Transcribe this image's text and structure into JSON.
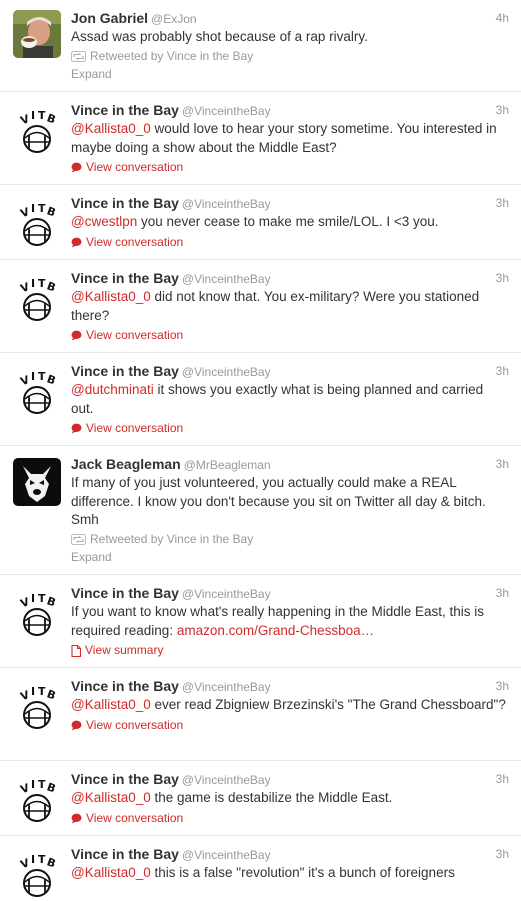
{
  "tweets": [
    {
      "name": "Jon Gabriel",
      "handle": "@ExJon",
      "time": "4h",
      "avatar": "photo-avatar",
      "segments": [
        {
          "type": "text",
          "value": "Assad was probably shot because of a rap rivalry."
        }
      ],
      "retweeted_by": "Retweeted by Vince in the Bay",
      "expand": "Expand"
    },
    {
      "name": "Vince in the Bay",
      "handle": "@VinceintheBay",
      "time": "3h",
      "avatar": "vitb-avatar",
      "segments": [
        {
          "type": "mention",
          "value": "@Kallista0_0"
        },
        {
          "type": "text",
          "value": " would love to hear your story sometime. You interested in maybe doing a show about the Middle East?"
        }
      ],
      "action": "View conversation",
      "action_icon": "speech-bubble-icon"
    },
    {
      "name": "Vince in the Bay",
      "handle": "@VinceintheBay",
      "time": "3h",
      "avatar": "vitb-avatar",
      "segments": [
        {
          "type": "mention",
          "value": "@cwestlpn"
        },
        {
          "type": "text",
          "value": " you never cease to make me smile/LOL. I <3 you."
        }
      ],
      "action": "View conversation",
      "action_icon": "speech-bubble-icon"
    },
    {
      "name": "Vince in the Bay",
      "handle": "@VinceintheBay",
      "time": "3h",
      "avatar": "vitb-avatar",
      "segments": [
        {
          "type": "mention",
          "value": "@Kallista0_0"
        },
        {
          "type": "text",
          "value": " did not know that. You ex-military? Were you stationed there?"
        }
      ],
      "action": "View conversation",
      "action_icon": "speech-bubble-icon"
    },
    {
      "name": "Vince in the Bay",
      "handle": "@VinceintheBay",
      "time": "3h",
      "avatar": "vitb-avatar",
      "segments": [
        {
          "type": "mention",
          "value": "@dutchminati"
        },
        {
          "type": "text",
          "value": " it shows you exactly what is being planned and carried out."
        }
      ],
      "action": "View conversation",
      "action_icon": "speech-bubble-icon"
    },
    {
      "name": "Jack Beagleman",
      "handle": "@MrBeagleman",
      "time": "3h",
      "avatar": "dog-avatar",
      "segments": [
        {
          "type": "text",
          "value": "If many of you just volunteered, you actually could make a REAL difference. I know you don't because you sit on Twitter all day & bitch. Smh"
        }
      ],
      "retweeted_by": "Retweeted by Vince in the Bay",
      "expand": "Expand"
    },
    {
      "name": "Vince in the Bay",
      "handle": "@VinceintheBay",
      "time": "3h",
      "avatar": "vitb-avatar",
      "segments": [
        {
          "type": "text",
          "value": "If you want to know what's really happening in the Middle East, this is required reading: "
        },
        {
          "type": "link",
          "value": "amazon.com/Grand-Chessboa…"
        }
      ],
      "action": "View summary",
      "action_icon": "document-icon"
    },
    {
      "name": "Vince in the Bay",
      "handle": "@VinceintheBay",
      "time": "3h",
      "avatar": "vitb-avatar",
      "segments": [
        {
          "type": "mention",
          "value": "@Kallista0_0"
        },
        {
          "type": "text",
          "value": " ever read Zbigniew Brzezinski's \"The Grand Chessboard\"?"
        }
      ],
      "action": "View conversation",
      "action_icon": "speech-bubble-icon"
    },
    {
      "name": "Vince in the Bay",
      "handle": "@VinceintheBay",
      "time": "3h",
      "avatar": "vitb-avatar",
      "segments": [
        {
          "type": "mention",
          "value": "@Kallista0_0"
        },
        {
          "type": "text",
          "value": " the game is destabilize the Middle East."
        }
      ],
      "action": "View conversation",
      "action_icon": "speech-bubble-icon"
    },
    {
      "name": "Vince in the Bay",
      "handle": "@VinceintheBay",
      "time": "3h",
      "avatar": "vitb-avatar",
      "segments": [
        {
          "type": "mention",
          "value": "@Kallista0_0"
        },
        {
          "type": "text",
          "value": " this is a false \"revolution\" it's a bunch of foreigners"
        }
      ]
    }
  ],
  "colors": {
    "link": "#d02b2b",
    "muted": "#999999",
    "text": "#333333",
    "border": "#e8e8e8"
  }
}
